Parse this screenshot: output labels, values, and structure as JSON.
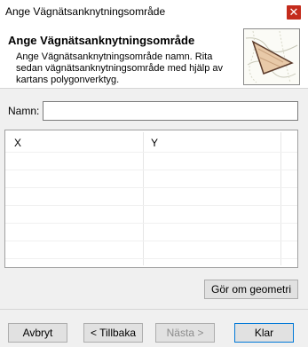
{
  "window": {
    "title": "Ange Vägnätsanknytningsområde",
    "close_glyph": "✕"
  },
  "header": {
    "title": "Ange Vägnätsanknytningsområde",
    "description": "Ange Vägnätsanknytningsområde namn. Rita sedan vägnätsanknytningsområde med hjälp av kartans polygonverktyg.",
    "image_icon": "polygon-map-icon"
  },
  "form": {
    "name_label": "Namn:",
    "name_value": ""
  },
  "table": {
    "columns": [
      "X",
      "Y"
    ],
    "rows": []
  },
  "buttons": {
    "redo_geometry": "Gör om geometri",
    "cancel": "Avbryt",
    "back": "< Tillbaka",
    "next": "Nästa >",
    "finish": "Klar"
  },
  "colors": {
    "close": "#c42b1c",
    "default_border": "#0078d7"
  }
}
